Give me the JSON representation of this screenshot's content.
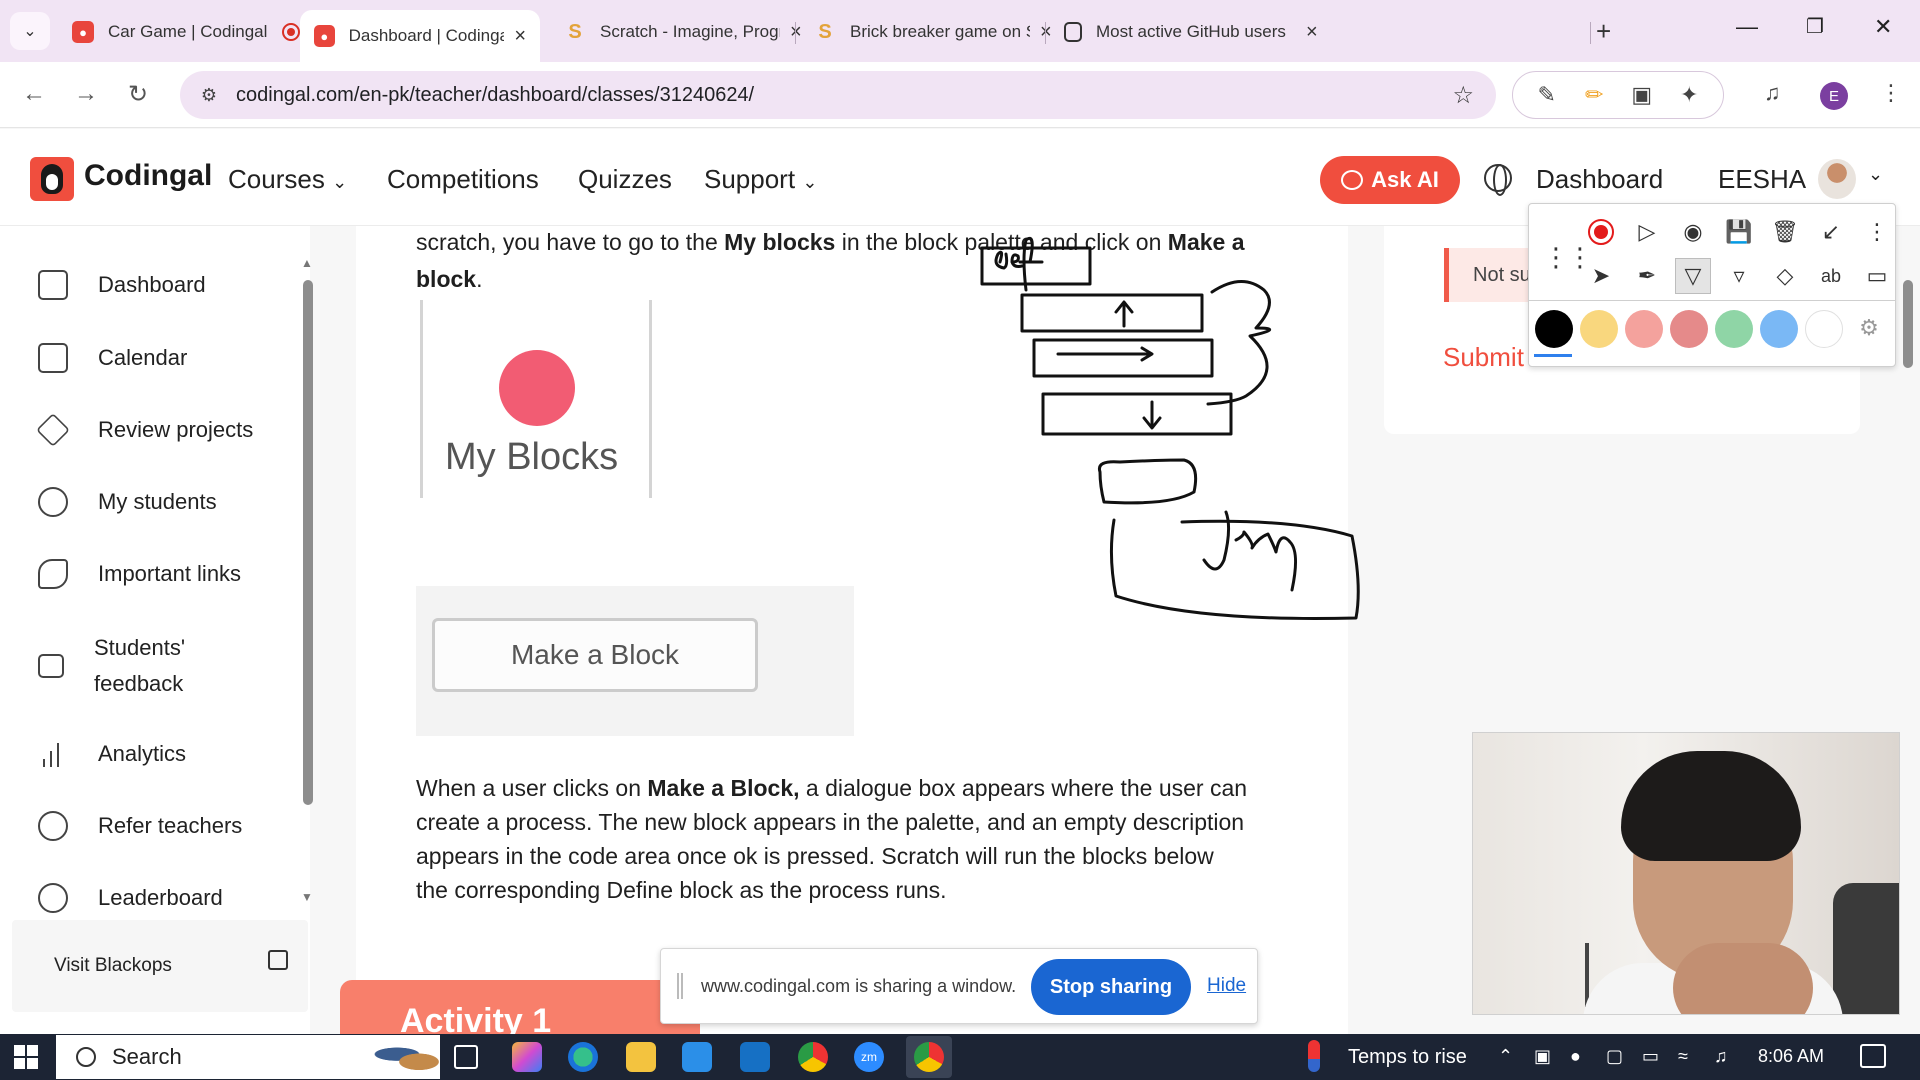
{
  "browser": {
    "tabs": [
      {
        "title": "Car Game | Codingal",
        "favicon": "codingal-icon",
        "recording": true
      },
      {
        "title": "Dashboard | Codingal",
        "favicon": "codingal-icon",
        "active": true
      },
      {
        "title": "Scratch - Imagine, Progra",
        "favicon": "scratch-icon"
      },
      {
        "title": "Brick breaker game on Sc",
        "favicon": "scratch-icon"
      },
      {
        "title": "Most active GitHub users",
        "favicon": "github-icon"
      }
    ],
    "url": "codingal.com/en-pk/teacher/dashboard/classes/31240624/",
    "profile_initial": "E"
  },
  "site": {
    "logo_text": "Codingal",
    "nav": {
      "courses": "Courses",
      "competitions": "Competitions",
      "quizzes": "Quizzes",
      "support": "Support"
    },
    "ask_ai": "Ask AI",
    "dashboard_link": "Dashboard",
    "user_name": "EESHA"
  },
  "sidebar": {
    "items": [
      {
        "label": "Dashboard",
        "icon": "clipboard-icon"
      },
      {
        "label": "Calendar",
        "icon": "calendar-icon"
      },
      {
        "label": "Review projects",
        "icon": "cube-icon"
      },
      {
        "label": "My students",
        "icon": "users-icon"
      },
      {
        "label": "Important links",
        "icon": "link-icon"
      },
      {
        "label": "Students' feedback",
        "icon": "feedback-icon"
      },
      {
        "label": "Analytics",
        "icon": "analytics-icon"
      },
      {
        "label": "Refer teachers",
        "icon": "refer-icon"
      },
      {
        "label": "Leaderboard",
        "icon": "trophy-icon"
      }
    ],
    "visit_blackops": "Visit Blackops"
  },
  "content": {
    "intro_line1_pre": "scratch, you have to go to the ",
    "intro_line1_bold1": "My blocks",
    "intro_line1_mid": " in the block palette and click on ",
    "intro_line1_bold2": "Make a",
    "intro_line2_bold": "block",
    "intro_line2_post": ".",
    "myblocks_label": "My Blocks",
    "make_block_button": "Make a Block",
    "para2_pre": "When a user clicks on ",
    "para2_bold": "Make a Block,",
    "para2_line1_post": " a dialogue box appears where the user can",
    "para2_line2": "create a process. The new block appears in the palette, and an empty description",
    "para2_line3": "appears in the code area once ok is pressed. Scratch will run the blocks below",
    "para2_line4": "the corresponding Define block as the process runs.",
    "activity_title": "Activity 1"
  },
  "right_panel": {
    "not_submitted": "Not su",
    "submit": "Submit"
  },
  "annotation_toolbar": {
    "colors": [
      "#000000",
      "#f9d77e",
      "#f4a29d",
      "#e58a8a",
      "#8fd5a6",
      "#7ab8f5",
      "#ffffff"
    ],
    "selected_color": "#000000"
  },
  "share_bar": {
    "message": "www.codingal.com is sharing a window.",
    "stop_button": "Stop sharing",
    "hide_link": "Hide"
  },
  "taskbar": {
    "search": "Search",
    "weather": "Temps to rise",
    "time": "8:06 AM"
  }
}
